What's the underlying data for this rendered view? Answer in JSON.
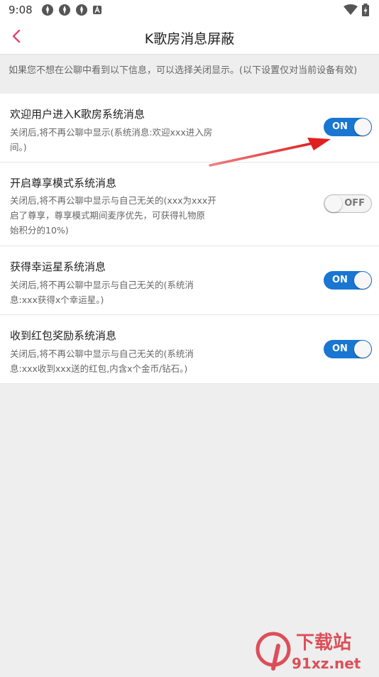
{
  "status_bar": {
    "time": "9:08",
    "left_icons": [
      "app-notification-icon",
      "app-notification-icon",
      "app-notification-icon",
      "a-badge-icon"
    ],
    "right_icons": [
      "wifi-icon",
      "battery-charging-icon"
    ]
  },
  "app_bar": {
    "title": "K歌房消息屏蔽",
    "back_icon": "chevron-left-icon",
    "accent_color": "#e8456b"
  },
  "notice_text": "如果您不想在公聊中看到以下信息，可以选择关闭显示。(以下设置仅对当前设备有效)",
  "settings": [
    {
      "title": "欢迎用户进入K歌房系统消息",
      "desc_line1": "关闭后,将不再公聊中显示(系统消息:欢迎xxx进入房",
      "desc_line2": "间。)",
      "desc_line3": "",
      "toggle_state": "ON",
      "enabled": true
    },
    {
      "title": "开启尊享模式系统消息",
      "desc_line1": "关闭后,将不再公聊中显示与自己无关的(xxx为xxx开",
      "desc_line2": "启了尊享，尊享模式期间麦序优先，可获得礼物原",
      "desc_line3": "始积分的10%)",
      "toggle_state": "OFF",
      "enabled": false
    },
    {
      "title": "获得幸运星系统消息",
      "desc_line1": "关闭后,将不再公聊中显示与自己无关的(系统消",
      "desc_line2": "息:xxx获得x个幸运星。)",
      "desc_line3": "",
      "toggle_state": "ON",
      "enabled": true
    },
    {
      "title": "收到红包奖励系统消息",
      "desc_line1": "关闭后,将不再公聊中显示与自己无关的(系统消",
      "desc_line2": "息:xxx收到xxx送的红包,内含x个金币/钻石。)",
      "desc_line3": "",
      "toggle_state": "ON",
      "enabled": true
    }
  ],
  "annotation": {
    "type": "red-arrow-icon",
    "color": "#e02020"
  },
  "watermark": {
    "logo_text": "9",
    "site_text": "91xz.net",
    "brand_text": "下载站",
    "color": "#d9343f"
  },
  "colors": {
    "toggle_on": "#1976d2",
    "toggle_off": "#f4f4f4",
    "background": "#eeeeee"
  }
}
